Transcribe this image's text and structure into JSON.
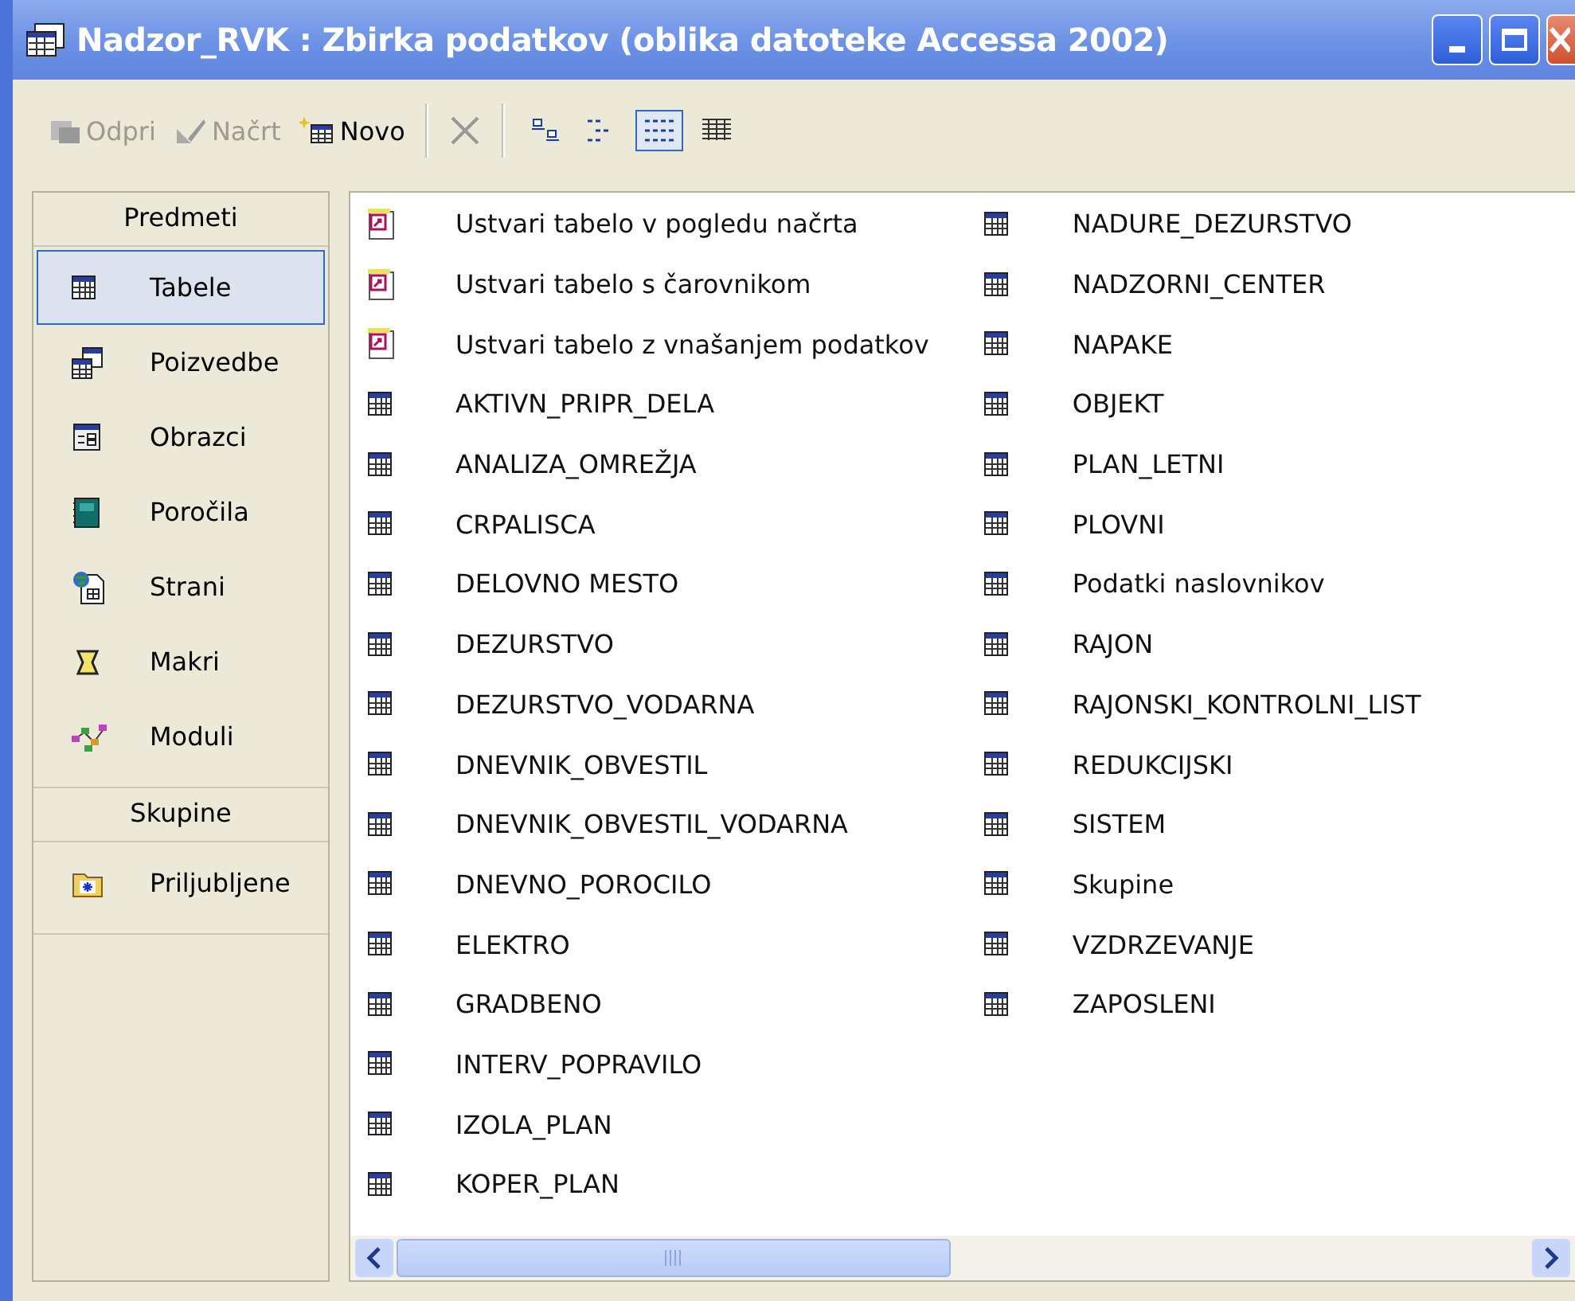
{
  "window": {
    "title": "Nadzor_RVK : Zbirka podatkov (oblika datoteke Accessa 2002)"
  },
  "toolbar": {
    "actions": [
      {
        "kind": "open",
        "label": "Odpri",
        "disabled": true
      },
      {
        "kind": "design",
        "label": "Načrt",
        "disabled": true
      },
      {
        "kind": "new",
        "label": "Novo",
        "disabled": false
      },
      {
        "kind": "delete",
        "disabled": true
      }
    ],
    "views": [
      {
        "kind": "large-icons",
        "selected": false
      },
      {
        "kind": "small-icons",
        "selected": false
      },
      {
        "kind": "list",
        "selected": true
      },
      {
        "kind": "details",
        "selected": false
      }
    ]
  },
  "sidebar": {
    "groups": [
      {
        "title": "Predmeti",
        "items": [
          {
            "kind": "table",
            "label": "Tabele",
            "selected": true
          },
          {
            "kind": "query",
            "label": "Poizvedbe",
            "selected": false
          },
          {
            "kind": "form",
            "label": "Obrazci",
            "selected": false
          },
          {
            "kind": "report",
            "label": "Poročila",
            "selected": false
          },
          {
            "kind": "page",
            "label": "Strani",
            "selected": false
          },
          {
            "kind": "macro",
            "label": "Makri",
            "selected": false
          },
          {
            "kind": "module",
            "label": "Moduli",
            "selected": false
          }
        ]
      },
      {
        "title": "Skupine",
        "items": [
          {
            "kind": "favorites",
            "label": "Priljubljene",
            "selected": false
          }
        ]
      }
    ]
  },
  "objects": [
    {
      "kind": "shortcut",
      "label": "Ustvari tabelo v pogledu načrta"
    },
    {
      "kind": "shortcut",
      "label": "Ustvari tabelo s čarovnikom"
    },
    {
      "kind": "shortcut",
      "label": "Ustvari tabelo z vnašanjem podatkov"
    },
    {
      "kind": "table",
      "label": "AKTIVN_PRIPR_DELA"
    },
    {
      "kind": "table",
      "label": "ANALIZA_OMREŽJA"
    },
    {
      "kind": "table",
      "label": "CRPALISCA"
    },
    {
      "kind": "table",
      "label": "DELOVNO MESTO"
    },
    {
      "kind": "table",
      "label": "DEZURSTVO"
    },
    {
      "kind": "table",
      "label": "DEZURSTVO_VODARNA"
    },
    {
      "kind": "table",
      "label": "DNEVNIK_OBVESTIL"
    },
    {
      "kind": "table",
      "label": "DNEVNIK_OBVESTIL_VODARNA"
    },
    {
      "kind": "table",
      "label": "DNEVNO_POROCILO"
    },
    {
      "kind": "table",
      "label": "ELEKTRO"
    },
    {
      "kind": "table",
      "label": "GRADBENO"
    },
    {
      "kind": "table",
      "label": "INTERV_POPRAVILO"
    },
    {
      "kind": "table",
      "label": "IZOLA_PLAN"
    },
    {
      "kind": "table",
      "label": "KOPER_PLAN"
    },
    {
      "kind": "table",
      "label": "NADURE_DEZURSTVO"
    },
    {
      "kind": "table",
      "label": "NADZORNI_CENTER"
    },
    {
      "kind": "table",
      "label": "NAPAKE"
    },
    {
      "kind": "table",
      "label": "OBJEKT"
    },
    {
      "kind": "table",
      "label": "PLAN_LETNI"
    },
    {
      "kind": "table",
      "label": "PLOVNI"
    },
    {
      "kind": "table",
      "label": "Podatki naslovnikov"
    },
    {
      "kind": "table",
      "label": "RAJON"
    },
    {
      "kind": "table",
      "label": "RAJONSKI_KONTROLNI_LIST"
    },
    {
      "kind": "table",
      "label": "REDUKCIJSKI"
    },
    {
      "kind": "table",
      "label": "SISTEM"
    },
    {
      "kind": "table",
      "label": "Skupine"
    },
    {
      "kind": "table",
      "label": "VZDRZEVANJE"
    },
    {
      "kind": "table",
      "label": "ZAPOSLENI"
    }
  ]
}
